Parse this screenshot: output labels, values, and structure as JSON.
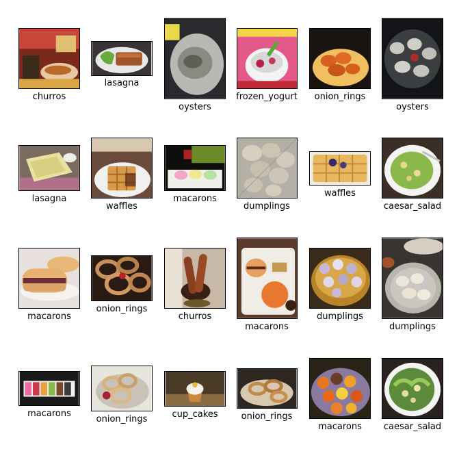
{
  "images": [
    {
      "label": "churros"
    },
    {
      "label": "lasagna"
    },
    {
      "label": "oysters"
    },
    {
      "label": "frozen_yogurt"
    },
    {
      "label": "onion_rings"
    },
    {
      "label": "oysters"
    },
    {
      "label": "lasagna"
    },
    {
      "label": "waffles"
    },
    {
      "label": "macarons"
    },
    {
      "label": "dumplings"
    },
    {
      "label": "waffles"
    },
    {
      "label": "caesar_salad"
    },
    {
      "label": "macarons"
    },
    {
      "label": "onion_rings"
    },
    {
      "label": "churros"
    },
    {
      "label": "macarons"
    },
    {
      "label": "dumplings"
    },
    {
      "label": "dumplings"
    },
    {
      "label": "macarons"
    },
    {
      "label": "onion_rings"
    },
    {
      "label": "cup_cakes"
    },
    {
      "label": "onion_rings"
    },
    {
      "label": "macarons"
    },
    {
      "label": "caesar_salad"
    }
  ]
}
